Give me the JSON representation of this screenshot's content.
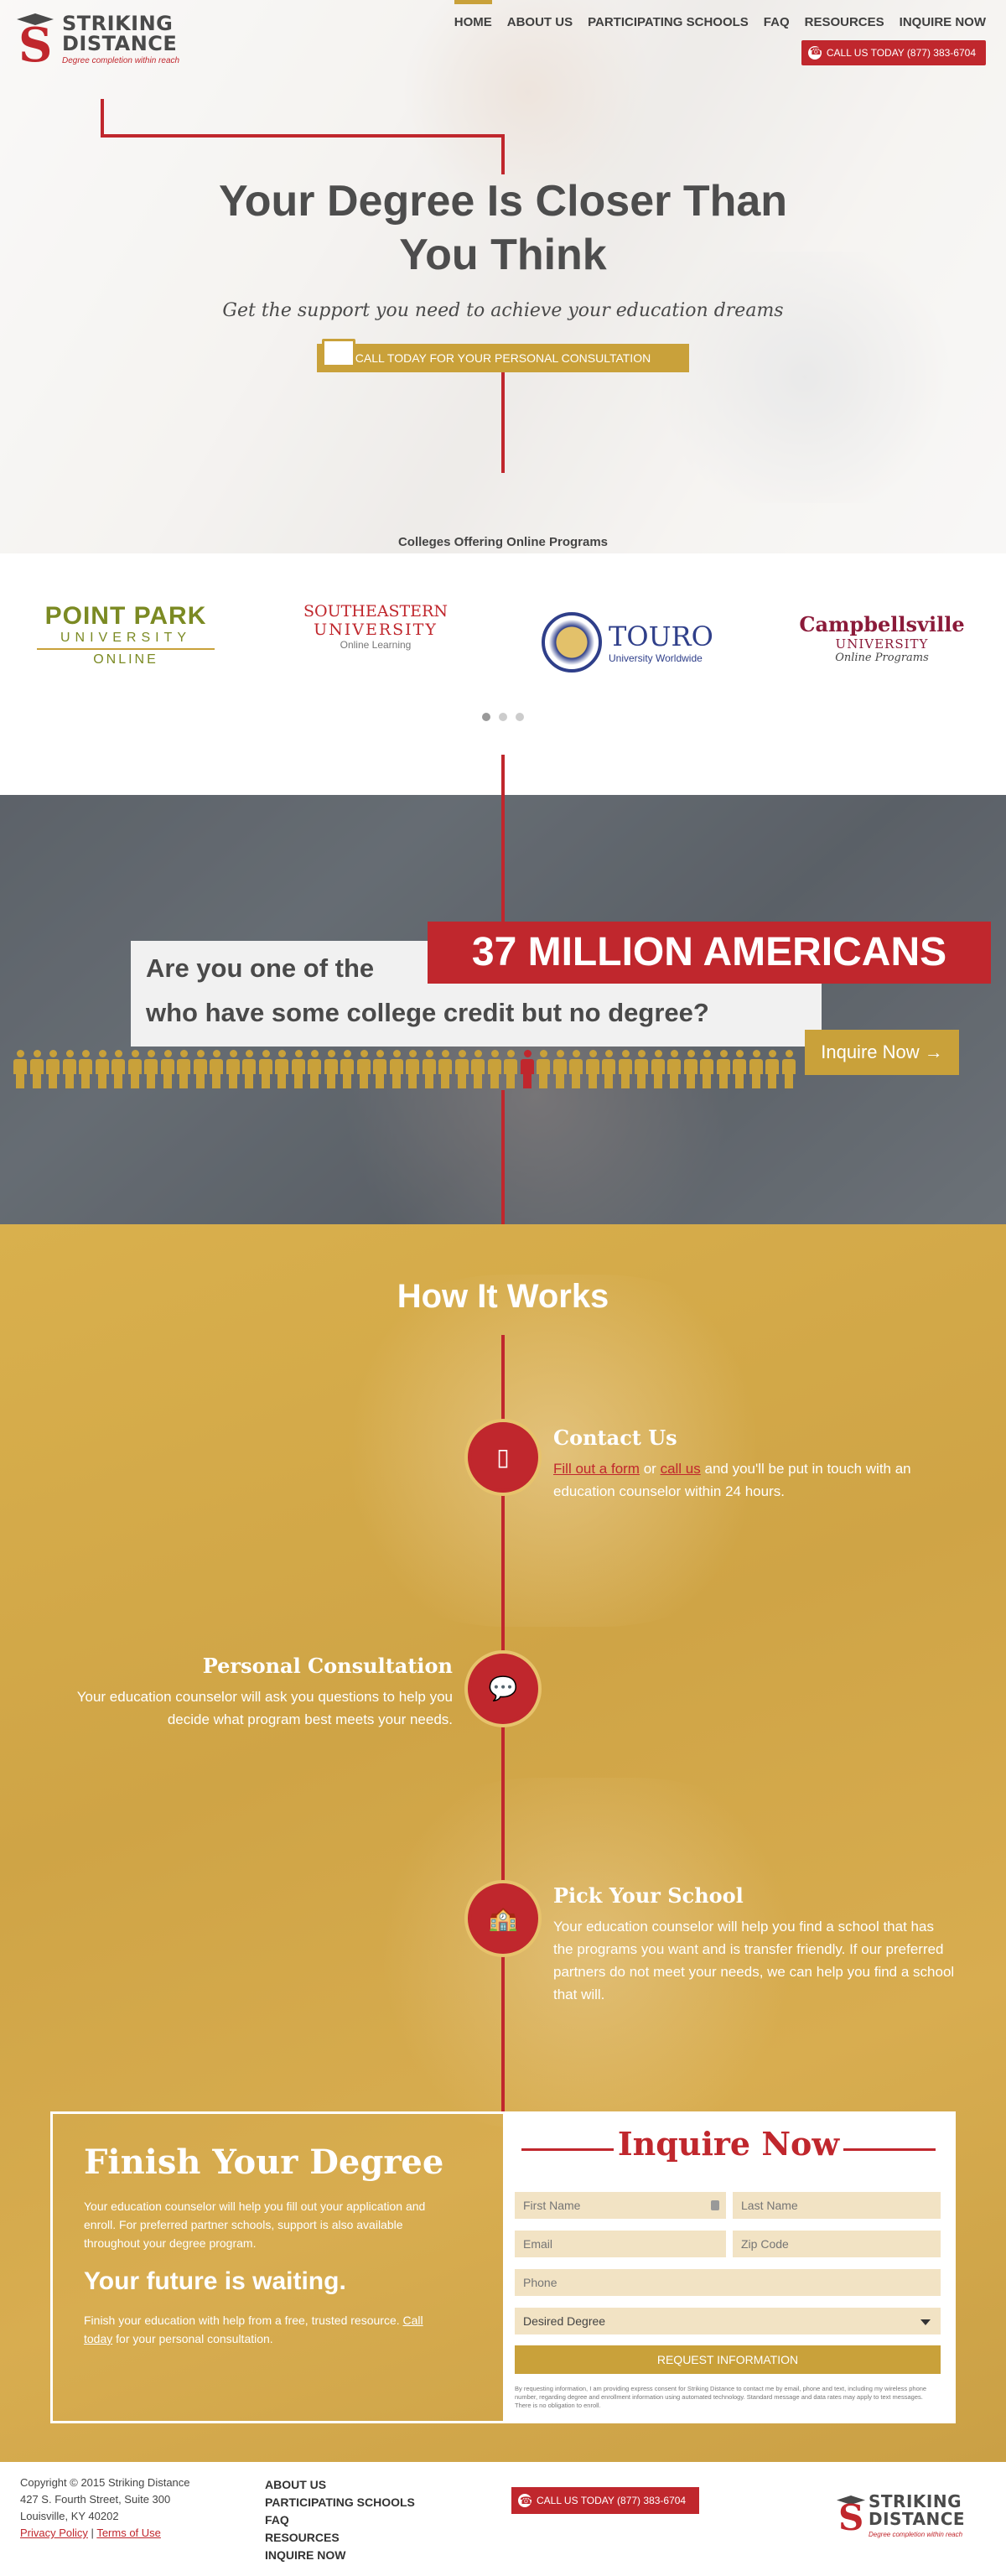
{
  "brand": {
    "line1": "STRIKING",
    "line2": "DISTANCE",
    "tagline": "Degree completion within reach"
  },
  "nav": [
    {
      "label": "HOME",
      "active": true
    },
    {
      "label": "ABOUT US"
    },
    {
      "label": "PARTICIPATING SCHOOLS"
    },
    {
      "label": "FAQ"
    },
    {
      "label": "RESOURCES"
    },
    {
      "label": "INQUIRE NOW"
    }
  ],
  "call_top": "CALL US TODAY (877) 383-6704",
  "hero": {
    "title_line1": "Your Degree Is Closer Than",
    "title_line2": "You Think",
    "subtitle": "Get the support you need to achieve your education dreams",
    "cta": "CALL TODAY FOR YOUR PERSONAL CONSULTATION",
    "colleges_label": "Colleges Offering Online Programs"
  },
  "colleges": [
    {
      "name_line1": "POINT PARK",
      "name_line2": "UNIVERSITY",
      "name_line3": "ONLINE"
    },
    {
      "name_line1": "SOUTHEASTERN",
      "name_line2": "UNIVERSITY",
      "name_line3": "Online Learning"
    },
    {
      "name_line1": "TOURO",
      "name_line2": "University Worldwide"
    },
    {
      "name_line1": "Campbellsville",
      "name_line2": "UNIVERSITY",
      "name_line3": "Online Programs"
    }
  ],
  "carousel": {
    "count": 3,
    "active": 1
  },
  "stats": {
    "question_line1": "Are you one of the",
    "question_line2": "who have some college credit but no degree?",
    "highlight": "37 MILLION AMERICANS",
    "button": "Inquire Now →",
    "people_count": 48,
    "highlight_index": 31,
    "colors": {
      "people": "#c9a13a",
      "highlight": "#c0272d"
    }
  },
  "how": {
    "title": "How It Works",
    "steps": [
      {
        "title": "Contact Us",
        "link1": "Fill out a form",
        "or": "or",
        "link2": "call us",
        "body": "and you'll be put in touch with an education counselor within 24 hours.",
        "icon": "phone-icon"
      },
      {
        "title": "Personal Consultation",
        "body": "Your education counselor will ask you questions to help you decide what program best meets your needs.",
        "icon": "chat-bubbles-icon"
      },
      {
        "title": "Pick Your School",
        "body": "Your education counselor will help you find a school that has the programs you want and is transfer friendly. If our preferred partners do not meet your needs, we can help you find a school that will.",
        "icon": "school-building-icon"
      }
    ]
  },
  "finish": {
    "title": "Finish Your Degree",
    "p1": "Your education counselor will help you fill out your application and enroll. For preferred partner schools, support is also available throughout your degree program.",
    "subtitle": "Your future is waiting.",
    "p2_prefix": "Finish your education with help from a free, trusted resource.",
    "p2_link": "Call today",
    "p2_suffix": "for your personal consultation."
  },
  "form": {
    "title": "Inquire Now",
    "first_name": "First Name",
    "last_name": "Last Name",
    "email": "Email",
    "zip": "Zip Code",
    "phone": "Phone",
    "degree_select": "Desired Degree",
    "submit": "REQUEST INFORMATION",
    "fine_print": "By requesting information, I am providing express consent for Striking Distance to contact me by email, phone and text, including my wireless phone number, regarding degree and enrollment information using automated technology. Standard message and data rates may apply to text messages. There is no obligation to enroll."
  },
  "footer": {
    "copyright": "Copyright © 2015 Striking Distance",
    "address1": "427 S. Fourth Street, Suite 300",
    "address2": "Louisville, KY 40202",
    "privacy": "Privacy Policy",
    "sep": "|",
    "terms": "Terms of Use",
    "nav": [
      "ABOUT US",
      "PARTICIPATING SCHOOLS",
      "FAQ",
      "RESOURCES",
      "INQUIRE NOW"
    ],
    "call": "CALL US TODAY (877) 383-6704"
  },
  "colors": {
    "red": "#c0272d",
    "gold": "#c9a13a",
    "dark": "#4a4a4a"
  }
}
